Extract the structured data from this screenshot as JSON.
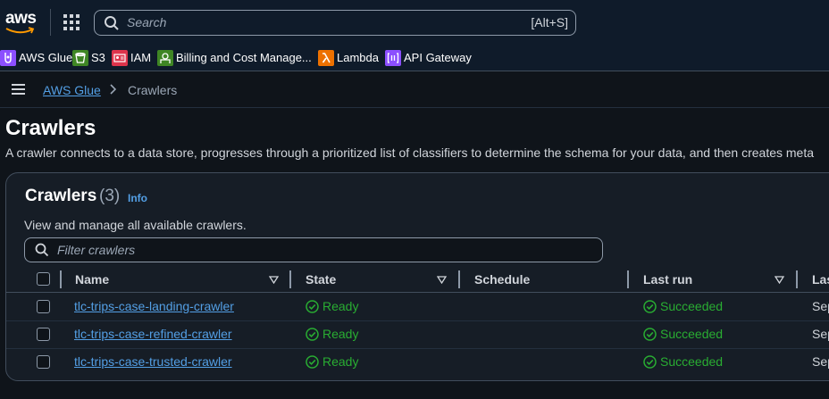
{
  "nav": {
    "logo": "aws",
    "search_placeholder": "Search",
    "search_shortcut": "[Alt+S]"
  },
  "favorites": [
    {
      "label": "AWS Glue",
      "icon": "aws-glue-icon",
      "color": "#8c4fff"
    },
    {
      "label": "S3",
      "icon": "s3-icon",
      "color": "#3f8624"
    },
    {
      "label": "IAM",
      "icon": "iam-icon",
      "color": "#dd344c"
    },
    {
      "label": "Billing and Cost Manage...",
      "icon": "billing-icon",
      "color": "#3f8624"
    },
    {
      "label": "Lambda",
      "icon": "lambda-icon",
      "color": "#ed7100"
    },
    {
      "label": "API Gateway",
      "icon": "api-gateway-icon",
      "color": "#8c4fff"
    }
  ],
  "breadcrumb": {
    "parent": "AWS Glue",
    "current": "Crawlers"
  },
  "page": {
    "title": "Crawlers",
    "description": "A crawler connects to a data store, progresses through a prioritized list of classifiers to determine the schema for your data, and then creates meta"
  },
  "panel": {
    "title": "Crawlers",
    "count": "(3)",
    "info": "Info",
    "description": "View and manage all available crawlers.",
    "filter_placeholder": "Filter crawlers"
  },
  "table": {
    "columns": [
      "Name",
      "State",
      "Schedule",
      "Last run",
      "Las"
    ],
    "rows": [
      {
        "name": "tlc-trips-case-landing-crawler",
        "state": "Ready",
        "schedule": "",
        "last_run": "Succeeded",
        "truncated": "Sep"
      },
      {
        "name": "tlc-trips-case-refined-crawler",
        "state": "Ready",
        "schedule": "",
        "last_run": "Succeeded",
        "truncated": "Sep"
      },
      {
        "name": "tlc-trips-case-trusted-crawler",
        "state": "Ready",
        "schedule": "",
        "last_run": "Succeeded",
        "truncated": "Sep"
      }
    ]
  },
  "colors": {
    "link": "#539fe5",
    "success": "#29ad32",
    "background": "#0f141a",
    "nav": "#0f1b2a"
  }
}
